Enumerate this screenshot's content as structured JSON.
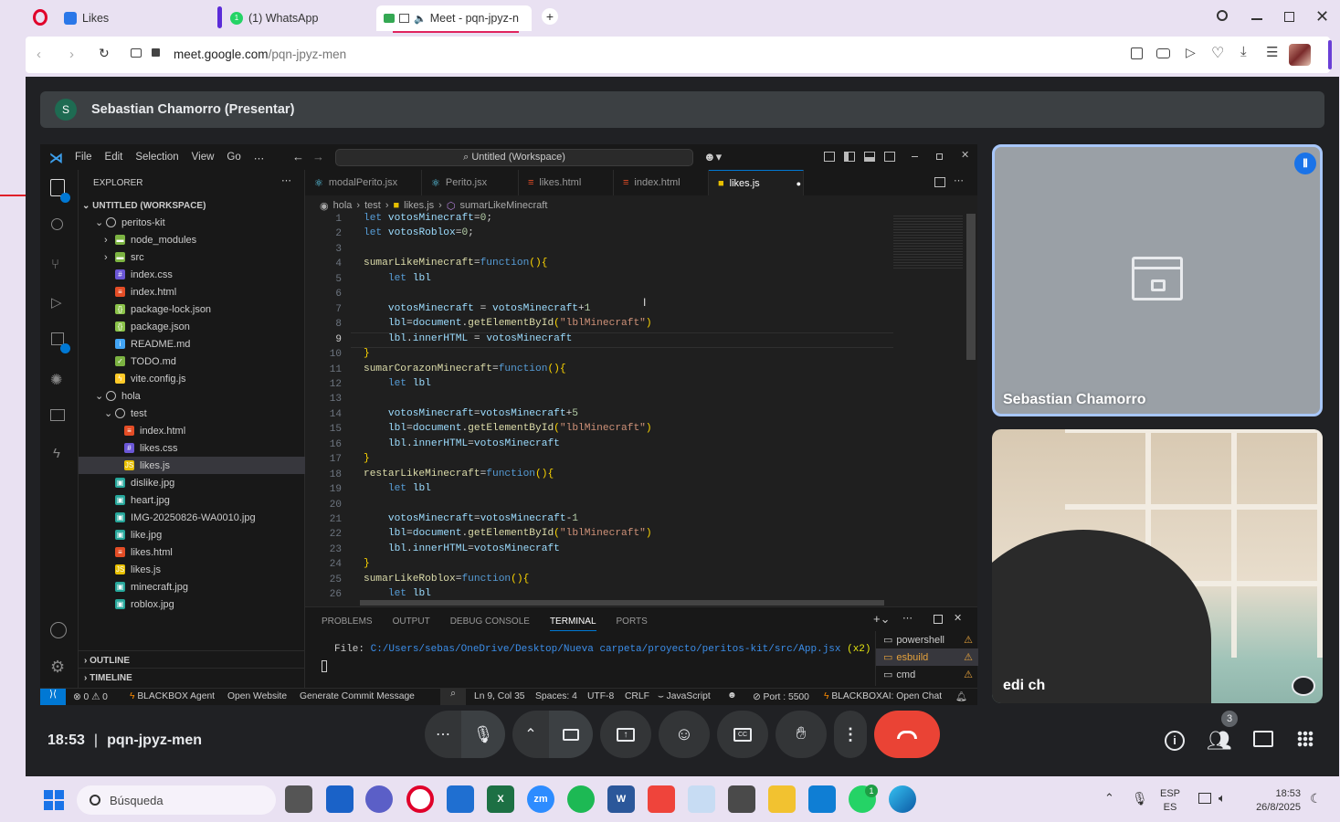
{
  "browser": {
    "tabs": [
      {
        "title": "Likes"
      },
      {
        "title": "(1) WhatsApp",
        "badge": "1"
      },
      {
        "title": "Meet - pqn-jpyz-n"
      }
    ],
    "url_host": "meet.google.com",
    "url_path": "/pqn-jpyz-men"
  },
  "meet": {
    "presenter_initial": "S",
    "presenter_banner": "Sebastian Chamorro (Presentar)",
    "tiles": [
      {
        "name": "Sebastian Chamorro"
      },
      {
        "name": "edi ch"
      }
    ],
    "time": "18:53",
    "separator": "|",
    "meeting_code": "pqn-jpyz-men",
    "participants_count": "3"
  },
  "vscode": {
    "menu": [
      "File",
      "Edit",
      "Selection",
      "View",
      "Go",
      "⋯"
    ],
    "search": "Untitled (Workspace)",
    "explorer_title": "EXPLORER",
    "workspace": "UNTITLED (WORKSPACE)",
    "tree": [
      {
        "label": "peritos-kit",
        "kind": "folder-open"
      },
      {
        "label": "node_modules",
        "kind": "folder"
      },
      {
        "label": "src",
        "kind": "folder"
      },
      {
        "label": "index.css",
        "kind": "css"
      },
      {
        "label": "index.html",
        "kind": "html"
      },
      {
        "label": "package-lock.json",
        "kind": "json"
      },
      {
        "label": "package.json",
        "kind": "json"
      },
      {
        "label": "README.md",
        "kind": "info"
      },
      {
        "label": "TODO.md",
        "kind": "todo"
      },
      {
        "label": "vite.config.js",
        "kind": "vite"
      },
      {
        "label": "hola",
        "kind": "folder-open"
      },
      {
        "label": "test",
        "kind": "folder-open"
      },
      {
        "label": "index.html",
        "kind": "html"
      },
      {
        "label": "likes.css",
        "kind": "css"
      },
      {
        "label": "likes.js",
        "kind": "js"
      },
      {
        "label": "dislike.jpg",
        "kind": "img"
      },
      {
        "label": "heart.jpg",
        "kind": "img"
      },
      {
        "label": "IMG-20250826-WA0010.jpg",
        "kind": "img"
      },
      {
        "label": "like.jpg",
        "kind": "img"
      },
      {
        "label": "likes.html",
        "kind": "html"
      },
      {
        "label": "likes.js",
        "kind": "js"
      },
      {
        "label": "minecraft.jpg",
        "kind": "img"
      },
      {
        "label": "roblox.jpg",
        "kind": "img"
      }
    ],
    "outline": "OUTLINE",
    "timeline": "TIMELINE",
    "editor_tabs": [
      "modalPerito.jsx",
      "Perito.jsx",
      "likes.html",
      "index.html",
      "likes.js"
    ],
    "breadcrumb": [
      "hola",
      "test",
      "likes.js",
      "sumarLikeMinecraft"
    ],
    "code_lines": [
      "let votosMinecraft=0;",
      "let votosRoblox=0;",
      "",
      "sumarLikeMinecraft=function(){",
      "    let lbl",
      "",
      "    votosMinecraft = votosMinecraft+1",
      "    lbl=document.getElementById(\"lblMinecraft\")",
      "    lbl.innerHTML = votosMinecraft",
      "}",
      "sumarCorazonMinecraft=function(){",
      "    let lbl",
      "",
      "    votosMinecraft=votosMinecraft+5",
      "    lbl=document.getElementById(\"lblMinecraft\")",
      "    lbl.innerHTML=votosMinecraft",
      "}",
      "restarLikeMinecraft=function(){",
      "    let lbl",
      "",
      "    votosMinecraft=votosMinecraft-1",
      "    lbl=document.getElementById(\"lblMinecraft\")",
      "    lbl.innerHTML=votosMinecraft",
      "}",
      "sumarLikeRoblox=function(){",
      "    let lbl"
    ],
    "panel_tabs": [
      "PROBLEMS",
      "OUTPUT",
      "DEBUG CONSOLE",
      "TERMINAL",
      "PORTS"
    ],
    "terminal_prefix": "File: ",
    "terminal_path": "C:/Users/sebas/OneDrive/Desktop/Nueva carpeta/proyecto/peritos-kit/src/App.jsx",
    "terminal_suffix": " (x2)",
    "terminals": [
      "powershell",
      "esbuild",
      "cmd"
    ],
    "status": {
      "errors": "⊗ 0 ⚠ 0",
      "blackbox_agent": "BLACKBOX Agent",
      "open_website": "Open Website",
      "commit": "Generate Commit Message",
      "position": "Ln 9, Col 35",
      "spaces": "Spaces: 4",
      "encoding": "UTF-8",
      "eol": "CRLF",
      "language": "JavaScript",
      "port": "Port : 5500",
      "chat": "BLACKBOXAI: Open Chat"
    }
  },
  "taskbar": {
    "search_placeholder": "Búsqueda",
    "lang_top": "ESP",
    "lang_bottom": "ES",
    "clock_time": "18:53",
    "clock_date": "26/8/2025",
    "whatsapp_badge": "1"
  },
  "colors": {
    "meet_bg": "#202124",
    "vscode_bg": "#1f1f1f",
    "hangup": "#ea4335",
    "accent_blue": "#0078d4"
  }
}
